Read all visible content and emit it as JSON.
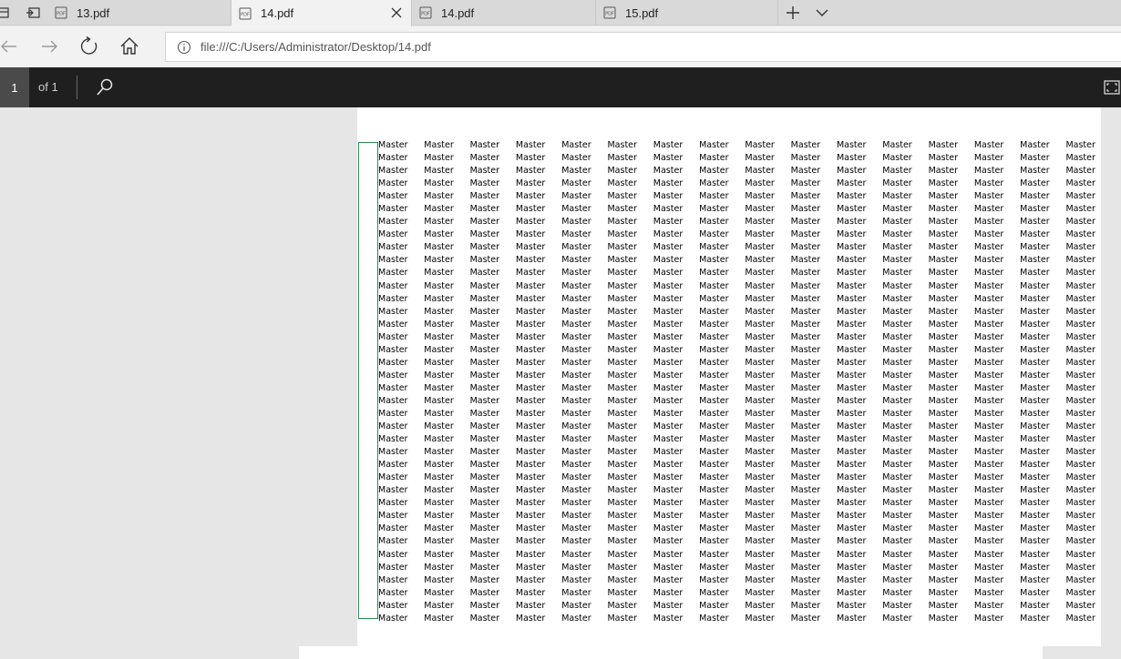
{
  "tabs": [
    {
      "label": "13.pdf",
      "active": false
    },
    {
      "label": "14.pdf",
      "active": true
    },
    {
      "label": "14.pdf",
      "active": false
    },
    {
      "label": "15.pdf",
      "active": false
    }
  ],
  "address": {
    "url": "file:///C:/Users/Administrator/Desktop/14.pdf"
  },
  "pdf_toolbar": {
    "page_number": "1",
    "page_of": "of 1"
  },
  "document": {
    "cell_text": "Master",
    "columns": 16,
    "rows": 38
  },
  "colors": {
    "toolbar_bg": "#1f1f1f",
    "selection_border": "#2e8b57",
    "viewer_bg": "#e6e6e6"
  }
}
